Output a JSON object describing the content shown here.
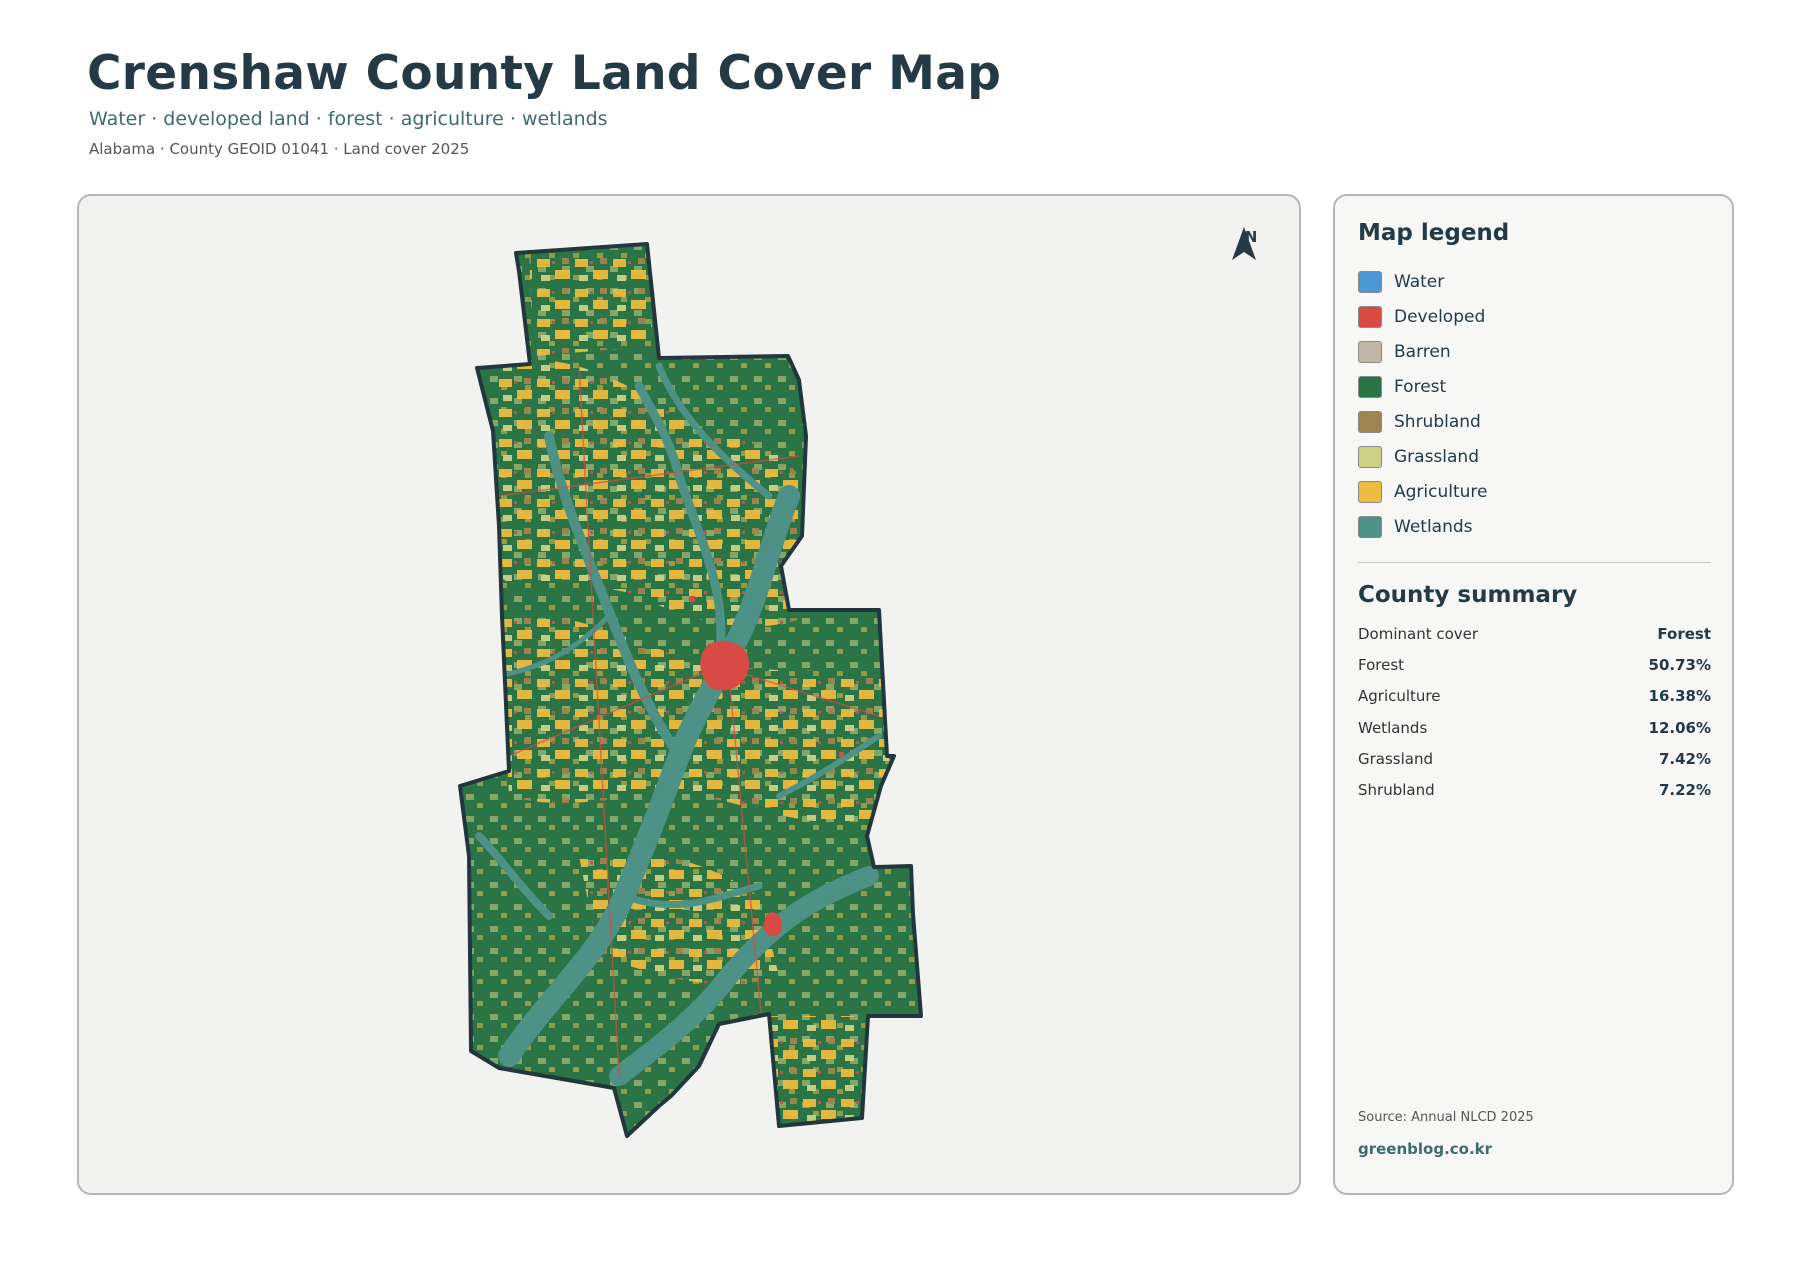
{
  "header": {
    "title": "Crenshaw County Land Cover Map",
    "subtitle": "Water · developed land · forest · agriculture · wetlands",
    "meta": "Alabama · County GEOID 01041 · Land cover 2025"
  },
  "map": {
    "north_label": "N",
    "north_icon": "north-arrow-icon",
    "border_color": "#22363d",
    "background_color": "#f2f2f0"
  },
  "legend": {
    "title": "Map legend",
    "items": [
      {
        "label": "Water",
        "color": "#4a98d4"
      },
      {
        "label": "Developed",
        "color": "#d94a45"
      },
      {
        "label": "Barren",
        "color": "#c0b6a6"
      },
      {
        "label": "Forest",
        "color": "#2a7446"
      },
      {
        "label": "Shrubland",
        "color": "#9e8550"
      },
      {
        "label": "Grassland",
        "color": "#cdd183"
      },
      {
        "label": "Agriculture",
        "color": "#ecbb3f"
      },
      {
        "label": "Wetlands",
        "color": "#4e9187"
      }
    ]
  },
  "summary": {
    "title": "County summary",
    "rows": [
      {
        "label": "Dominant cover",
        "value": "Forest"
      },
      {
        "label": "Forest",
        "value": "50.73%"
      },
      {
        "label": "Agriculture",
        "value": "16.38%"
      },
      {
        "label": "Wetlands",
        "value": "12.06%"
      },
      {
        "label": "Grassland",
        "value": "7.42%"
      },
      {
        "label": "Shrubland",
        "value": "7.22%"
      }
    ]
  },
  "footer": {
    "source": "Source: Annual NLCD 2025",
    "site": "greenblog.co.kr"
  }
}
